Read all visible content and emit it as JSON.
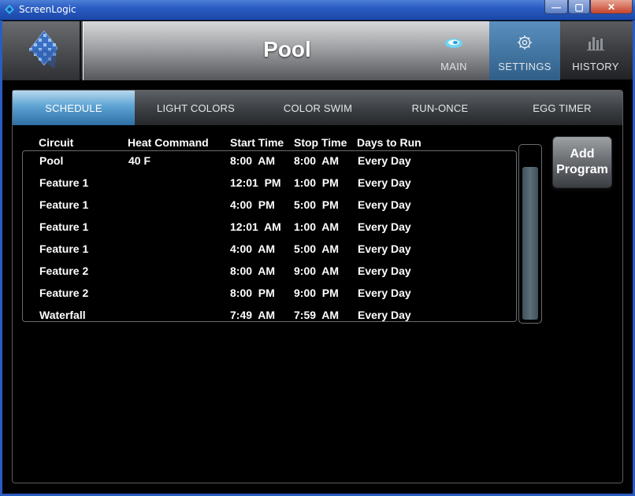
{
  "window": {
    "title": "ScreenLogic",
    "minimize_label": "—",
    "maximize_label": "▢",
    "close_label": "✕"
  },
  "header": {
    "title": "Pool",
    "nav": [
      {
        "label": "MAIN",
        "icon": "pool-icon"
      },
      {
        "label": "SETTINGS",
        "icon": "gear-icon",
        "active": true
      },
      {
        "label": "HISTORY",
        "icon": "bar-chart-icon"
      }
    ]
  },
  "tabs": [
    {
      "label": "SCHEDULE",
      "active": true
    },
    {
      "label": "LIGHT COLORS"
    },
    {
      "label": "COLOR SWIM"
    },
    {
      "label": "RUN-ONCE"
    },
    {
      "label": "EGG TIMER"
    }
  ],
  "schedule": {
    "columns": [
      "Circuit",
      "Heat Command",
      "Start Time",
      "Stop Time",
      "Days to Run"
    ],
    "rows": [
      {
        "circuit": "Pool",
        "heat": "40 F",
        "start": "8:00  AM",
        "stop": "8:00  AM",
        "days": "Every Day"
      },
      {
        "circuit": "Feature 1",
        "heat": "",
        "start": "12:01  PM",
        "stop": "1:00  PM",
        "days": "Every Day"
      },
      {
        "circuit": "Feature 1",
        "heat": "",
        "start": "4:00  PM",
        "stop": "5:00  PM",
        "days": "Every Day"
      },
      {
        "circuit": "Feature 1",
        "heat": "",
        "start": "12:01  AM",
        "stop": "1:00  AM",
        "days": "Every Day"
      },
      {
        "circuit": "Feature 1",
        "heat": "",
        "start": "4:00  AM",
        "stop": "5:00  AM",
        "days": "Every Day"
      },
      {
        "circuit": "Feature 2",
        "heat": "",
        "start": "8:00  AM",
        "stop": "9:00  AM",
        "days": "Every Day"
      },
      {
        "circuit": "Feature 2",
        "heat": "",
        "start": "8:00  PM",
        "stop": "9:00  PM",
        "days": "Every Day"
      },
      {
        "circuit": "Waterfall",
        "heat": "",
        "start": "7:49  AM",
        "stop": "7:59  AM",
        "days": "Every Day"
      }
    ]
  },
  "add_program": {
    "line1": "Add",
    "line2": "Program"
  },
  "colors": {
    "accent": "#5ea3d3",
    "titlebar": "#2a5cc2",
    "background": "#000000"
  }
}
